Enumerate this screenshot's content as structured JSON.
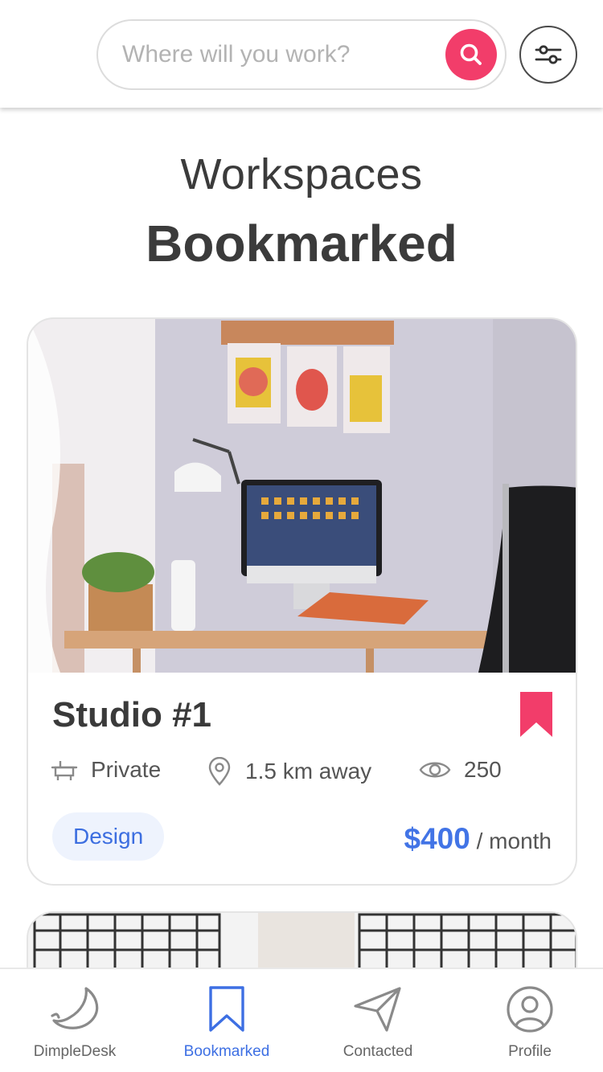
{
  "search": {
    "placeholder": "Where will you work?"
  },
  "heading": {
    "line1": "Workspaces",
    "line2": "Bookmarked"
  },
  "workspace": {
    "title": "Studio #1",
    "type": "Private",
    "distance": "1.5 km away",
    "views": "250",
    "tag": "Design",
    "price": "$400",
    "period": "/ month",
    "bookmarked": true
  },
  "nav": {
    "items": [
      {
        "label": "DimpleDesk",
        "icon": "melon-slice-icon",
        "active": false
      },
      {
        "label": "Bookmarked",
        "icon": "bookmark-icon",
        "active": true
      },
      {
        "label": "Contacted",
        "icon": "send-icon",
        "active": false
      },
      {
        "label": "Profile",
        "icon": "user-circle-icon",
        "active": false
      }
    ]
  },
  "colors": {
    "accent_pink": "#f23d6a",
    "accent_blue": "#4274e6",
    "text_dark": "#3b3b3b"
  }
}
